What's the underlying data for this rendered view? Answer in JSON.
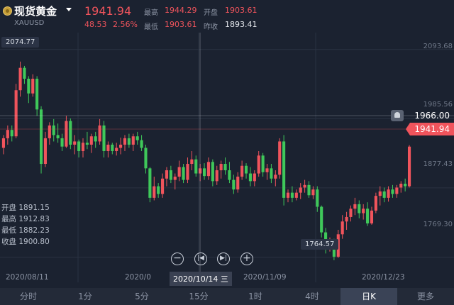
{
  "header": {
    "name": "现货黄金",
    "code": "XAUUSD",
    "price": "1941.94",
    "change": "48.53",
    "change_pct": "2.56%",
    "high_label": "最高",
    "high": "1944.29",
    "low_label": "最低",
    "low": "1903.61",
    "open_label": "开盘",
    "open": "1903.61",
    "prev_label": "昨收",
    "prev": "1893.41"
  },
  "ohlc": {
    "open": "开盘 1891.15",
    "high": "最高 1912.83",
    "low": "最低 1882.23",
    "close": "收盘 1900.80"
  },
  "y_axis": [
    "2093.68",
    "1985.56",
    "1877.43",
    "1769.30"
  ],
  "x_axis": [
    "2020/08/11",
    "2020/0",
    "2020/11/09",
    "2020/12/23"
  ],
  "max_tag": "2074.77",
  "min_tag": "1764.57",
  "alert_value": "1966.00",
  "price_tag": "1941.94",
  "crosshair_date": "2020/10/14 三",
  "controls": [
    "−",
    "|◀",
    "▶|",
    "+"
  ],
  "tabs": [
    "分时",
    "1分",
    "5分",
    "15分",
    "1时",
    "4时",
    "日K",
    "更多"
  ],
  "active_tab": "日K",
  "colors": {
    "up": "#f0545c",
    "down": "#3fc85a",
    "bg": "#1b2230"
  },
  "chart_data": {
    "type": "candlestick",
    "ylim": [
      1730,
      2120
    ],
    "candles": [
      [
        1940,
        1960,
        1930,
        1955
      ],
      [
        1955,
        1975,
        1945,
        1968
      ],
      [
        1968,
        1975,
        1950,
        1958
      ],
      [
        1958,
        2040,
        1955,
        2030
      ],
      [
        2030,
        2074.77,
        2020,
        2065
      ],
      [
        2065,
        2068,
        2040,
        2048
      ],
      [
        2048,
        2052,
        2010,
        2025
      ],
      [
        2025,
        2055,
        2020,
        2048
      ],
      [
        2048,
        2052,
        1990,
        2000
      ],
      [
        2000,
        2005,
        1900,
        1915
      ],
      [
        1915,
        1965,
        1910,
        1955
      ],
      [
        1955,
        1980,
        1945,
        1975
      ],
      [
        1975,
        1985,
        1950,
        1960
      ],
      [
        1960,
        1978,
        1948,
        1955
      ],
      [
        1955,
        1962,
        1935,
        1942
      ],
      [
        1942,
        1990,
        1940,
        1982
      ],
      [
        1982,
        1986,
        1938,
        1945
      ],
      [
        1945,
        1960,
        1930,
        1950
      ],
      [
        1950,
        1953,
        1925,
        1935
      ],
      [
        1935,
        1955,
        1925,
        1948
      ],
      [
        1948,
        1965,
        1938,
        1945
      ],
      [
        1945,
        1962,
        1932,
        1958
      ],
      [
        1958,
        1965,
        1940,
        1950
      ],
      [
        1950,
        1985,
        1945,
        1975
      ],
      [
        1975,
        1982,
        1925,
        1935
      ],
      [
        1935,
        1950,
        1925,
        1945
      ],
      [
        1945,
        1948,
        1930,
        1935
      ],
      [
        1935,
        1948,
        1928,
        1940
      ],
      [
        1940,
        1956,
        1930,
        1945
      ],
      [
        1945,
        1960,
        1935,
        1955
      ],
      [
        1955,
        1962,
        1940,
        1945
      ],
      [
        1945,
        1962,
        1935,
        1958
      ],
      [
        1958,
        1965,
        1945,
        1952
      ],
      [
        1952,
        1960,
        1935,
        1940
      ],
      [
        1940,
        1945,
        1900,
        1908
      ],
      [
        1908,
        1910,
        1855,
        1862
      ],
      [
        1862,
        1895,
        1858,
        1880
      ],
      [
        1880,
        1885,
        1862,
        1868
      ],
      [
        1868,
        1900,
        1862,
        1892
      ],
      [
        1892,
        1910,
        1880,
        1905
      ],
      [
        1905,
        1912,
        1885,
        1890
      ],
      [
        1890,
        1900,
        1875,
        1895
      ],
      [
        1895,
        1920,
        1888,
        1910
      ],
      [
        1910,
        1915,
        1885,
        1890
      ],
      [
        1890,
        1925,
        1885,
        1915
      ],
      [
        1915,
        1935,
        1905,
        1922
      ],
      [
        1922,
        1928,
        1895,
        1900
      ],
      [
        1900,
        1915,
        1888,
        1908
      ],
      [
        1908,
        1916,
        1890,
        1896
      ],
      [
        1896,
        1925,
        1890,
        1918
      ],
      [
        1918,
        1922,
        1880,
        1888
      ],
      [
        1888,
        1912,
        1882,
        1905
      ],
      [
        1905,
        1920,
        1892,
        1915
      ],
      [
        1915,
        1925,
        1898,
        1905
      ],
      [
        1905,
        1918,
        1885,
        1890
      ],
      [
        1890,
        1898,
        1868,
        1875
      ],
      [
        1875,
        1902,
        1870,
        1895
      ],
      [
        1895,
        1920,
        1890,
        1912
      ],
      [
        1912,
        1916,
        1892,
        1900
      ],
      [
        1900,
        1910,
        1880,
        1888
      ],
      [
        1888,
        1905,
        1880,
        1900
      ],
      [
        1900,
        1935,
        1895,
        1928
      ],
      [
        1928,
        1932,
        1895,
        1902
      ],
      [
        1902,
        1915,
        1890,
        1908
      ],
      [
        1908,
        1915,
        1885,
        1892
      ],
      [
        1892,
        1905,
        1880,
        1898
      ],
      [
        1898,
        1955,
        1892,
        1950
      ],
      [
        1950,
        1960,
        1850,
        1862
      ],
      [
        1862,
        1875,
        1855,
        1870
      ],
      [
        1870,
        1880,
        1855,
        1862
      ],
      [
        1862,
        1875,
        1858,
        1870
      ],
      [
        1870,
        1885,
        1860,
        1878
      ],
      [
        1878,
        1890,
        1870,
        1882
      ],
      [
        1882,
        1888,
        1862,
        1866
      ],
      [
        1866,
        1880,
        1860,
        1875
      ],
      [
        1875,
        1880,
        1840,
        1848
      ],
      [
        1848,
        1850,
        1800,
        1808
      ],
      [
        1808,
        1815,
        1775,
        1782
      ],
      [
        1782,
        1800,
        1778,
        1795
      ],
      [
        1795,
        1798,
        1764.57,
        1770
      ],
      [
        1770,
        1812,
        1768,
        1805
      ],
      [
        1805,
        1835,
        1798,
        1825
      ],
      [
        1825,
        1840,
        1812,
        1832
      ],
      [
        1832,
        1850,
        1825,
        1845
      ],
      [
        1845,
        1862,
        1835,
        1852
      ],
      [
        1852,
        1858,
        1830,
        1838
      ],
      [
        1838,
        1852,
        1828,
        1845
      ],
      [
        1845,
        1855,
        1818,
        1822
      ],
      [
        1822,
        1848,
        1820,
        1842
      ],
      [
        1842,
        1870,
        1838,
        1865
      ],
      [
        1865,
        1880,
        1850,
        1872
      ],
      [
        1872,
        1878,
        1855,
        1862
      ],
      [
        1862,
        1880,
        1856,
        1875
      ],
      [
        1875,
        1882,
        1862,
        1868
      ],
      [
        1868,
        1882,
        1862,
        1878
      ],
      [
        1878,
        1888,
        1870,
        1884
      ],
      [
        1884,
        1892,
        1872,
        1880
      ],
      [
        1880,
        1944.29,
        1878,
        1941.94
      ]
    ]
  }
}
